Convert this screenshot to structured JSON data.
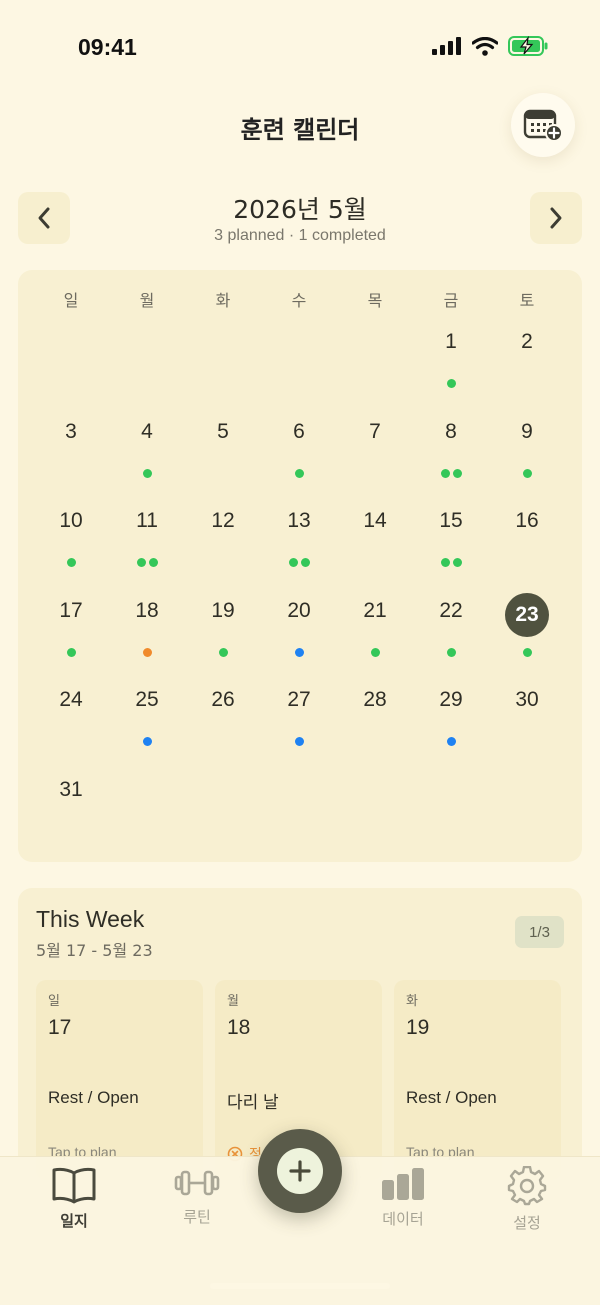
{
  "status_bar": {
    "time": "09:41"
  },
  "header": {
    "title": "훈련 캘린더",
    "calendar_add_icon": "calendar-plus-icon"
  },
  "calendar": {
    "month_title": "2026년 5월",
    "summary": "3 planned · 1 completed",
    "weekdays": [
      "일",
      "월",
      "화",
      "수",
      "목",
      "금",
      "토"
    ],
    "leading_blanks": 5,
    "selected_day": 23,
    "colors": {
      "green": "#34c759",
      "orange": "#f08a2c",
      "blue": "#1f82f2",
      "selected": "#50523f"
    },
    "days": [
      {
        "n": "1",
        "dots": [
          "green"
        ]
      },
      {
        "n": "2",
        "dots": []
      },
      {
        "n": "3",
        "dots": []
      },
      {
        "n": "4",
        "dots": [
          "green"
        ]
      },
      {
        "n": "5",
        "dots": []
      },
      {
        "n": "6",
        "dots": [
          "green"
        ]
      },
      {
        "n": "7",
        "dots": []
      },
      {
        "n": "8",
        "dots": [
          "green",
          "green"
        ]
      },
      {
        "n": "9",
        "dots": [
          "green"
        ]
      },
      {
        "n": "10",
        "dots": [
          "green"
        ]
      },
      {
        "n": "11",
        "dots": [
          "green",
          "green"
        ]
      },
      {
        "n": "12",
        "dots": []
      },
      {
        "n": "13",
        "dots": [
          "green",
          "green"
        ]
      },
      {
        "n": "14",
        "dots": []
      },
      {
        "n": "15",
        "dots": [
          "green",
          "green"
        ]
      },
      {
        "n": "16",
        "dots": []
      },
      {
        "n": "17",
        "dots": [
          "green"
        ]
      },
      {
        "n": "18",
        "dots": [
          "orange"
        ]
      },
      {
        "n": "19",
        "dots": [
          "green"
        ]
      },
      {
        "n": "20",
        "dots": [
          "blue"
        ]
      },
      {
        "n": "21",
        "dots": [
          "green"
        ]
      },
      {
        "n": "22",
        "dots": [
          "green"
        ]
      },
      {
        "n": "23",
        "dots": [
          "green"
        ]
      },
      {
        "n": "24",
        "dots": []
      },
      {
        "n": "25",
        "dots": [
          "blue"
        ]
      },
      {
        "n": "26",
        "dots": []
      },
      {
        "n": "27",
        "dots": [
          "blue"
        ]
      },
      {
        "n": "28",
        "dots": []
      },
      {
        "n": "29",
        "dots": [
          "blue"
        ]
      },
      {
        "n": "30",
        "dots": []
      },
      {
        "n": "31",
        "dots": []
      }
    ]
  },
  "this_week": {
    "title": "This Week",
    "range": "5월 17 - 5월 23",
    "badge": "1/3",
    "cards": [
      {
        "dow": "일",
        "day": "17",
        "label": "Rest / Open",
        "hint": "Tap to plan"
      },
      {
        "dow": "월",
        "day": "18",
        "label": "다리 날",
        "status": "정"
      },
      {
        "dow": "화",
        "day": "19",
        "label": "Rest / Open",
        "hint": "Tap to plan"
      }
    ]
  },
  "tab_bar": {
    "journal": "일지",
    "routine": "루틴",
    "data": "데이터",
    "settings": "설정",
    "add_icon": "plus-icon"
  }
}
